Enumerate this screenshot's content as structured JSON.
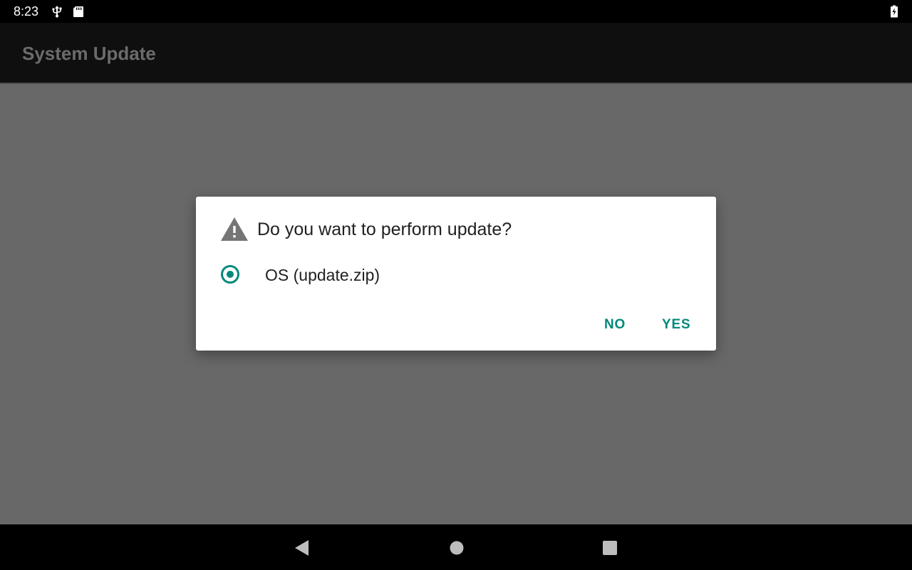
{
  "status_bar": {
    "time": "8:23",
    "icons": [
      "usb-icon",
      "sd-card-icon",
      "battery-charging-icon"
    ]
  },
  "app_bar": {
    "title": "System Update"
  },
  "dialog": {
    "icon": "warning-icon",
    "title": "Do you want to perform update?",
    "options": [
      {
        "label": "OS (update.zip)",
        "selected": true
      }
    ],
    "buttons": {
      "no_label": "NO",
      "yes_label": "YES"
    }
  },
  "nav_bar": {
    "icons": [
      "back-icon",
      "home-icon",
      "recents-icon"
    ]
  },
  "colors": {
    "accent": "#00897b",
    "scrim_background": "#686868",
    "app_bar": "#0f0f0f",
    "dialog_background": "#ffffff",
    "title_text": "#212121"
  }
}
